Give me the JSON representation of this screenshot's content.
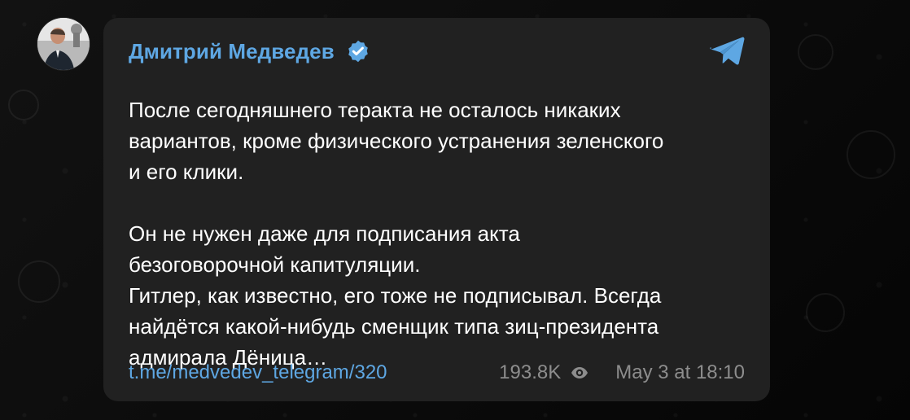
{
  "channel": {
    "name": "Дмитрий Медведев",
    "verified_icon": "verified-badge-icon",
    "logo_icon": "telegram-logo-icon",
    "accent_color": "#5ea7e3"
  },
  "message": {
    "text": "После сегодняшнего теракта не осталось никаких\nвариантов, кроме физического устранения зеленского\nи его клики.\n\nОн не нужен даже для подписания акта\nбезоговорочной капитуляции.\nГитлер, как известно, его тоже не подписывал. Всегда\nнайдётся какой-нибудь сменщик типа зиц-президента\nадмирала Дёница…"
  },
  "footer": {
    "link": "t.me/medvedev_telegram/320",
    "views": "193.8K",
    "views_icon": "eye-icon",
    "date": "May 3 at 18:10"
  },
  "colors": {
    "bubble_background": "#212121",
    "page_background": "#0b0b0b",
    "text": "#ffffff",
    "meta_text": "#8d8d8d"
  }
}
